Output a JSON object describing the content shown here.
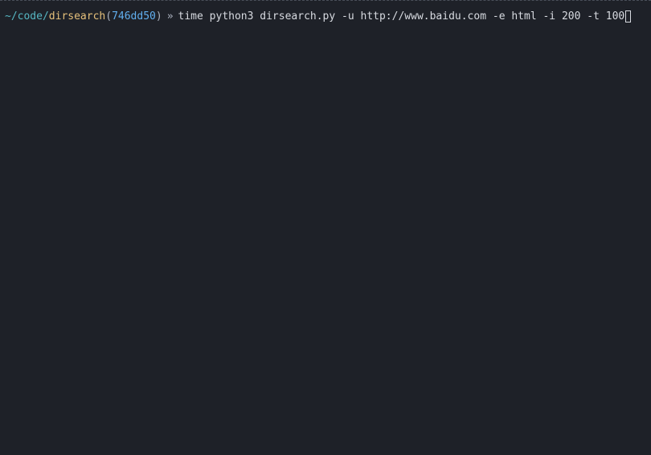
{
  "prompt": {
    "tilde": "~",
    "sep1": "/",
    "path1": "code",
    "sep2": "/",
    "path2": "dirsearch",
    "paren_open": "(",
    "git_hash": "746dd50",
    "paren_close": ")",
    "arrow": "»",
    "command": "time python3 dirsearch.py -u http://www.baidu.com -e html -i 200 -t 100"
  }
}
